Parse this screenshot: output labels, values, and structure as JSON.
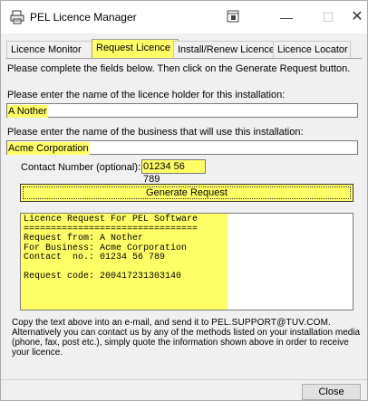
{
  "window": {
    "title": "PEL Licence Manager"
  },
  "tabs": [
    {
      "label": "Licence Monitor"
    },
    {
      "label": "Request Licence"
    },
    {
      "label": "Install/Renew Licence"
    },
    {
      "label": "Licence Locator"
    }
  ],
  "form": {
    "instructions": "Please complete the fields below. Then click on the Generate Request button.",
    "holder_label": "Please enter the name of the licence holder for this installation:",
    "holder_value": "A Nother",
    "business_label": "Please enter the name of the business that will use this installation:",
    "business_value": "Acme Corporation",
    "contact_label": "Contact Number (optional):",
    "contact_value": "01234 56 789",
    "generate_label": "Generate Request"
  },
  "request_output": {
    "lines": [
      "Licence Request For PEL Software",
      "================================",
      "Request from: A Nother",
      "For Business: Acme Corporation",
      "Contact  no.: 01234 56 789",
      "",
      "Request code: 200417231303140"
    ]
  },
  "info": {
    "line1_prefix": "Copy the text above into an e-mail, and send it to ",
    "email": "PEL.SUPPORT@TUV.COM",
    "line1_suffix": ".",
    "rest": "Alternatively you can contact us by any of the methods listed on your installation media (phone, fax, post etc.), simply quote the information shown above in order to receive your licence."
  },
  "footer": {
    "close_label": "Close"
  },
  "colors": {
    "highlight": "#ffff66",
    "window_bg": "#f0f0f0"
  }
}
